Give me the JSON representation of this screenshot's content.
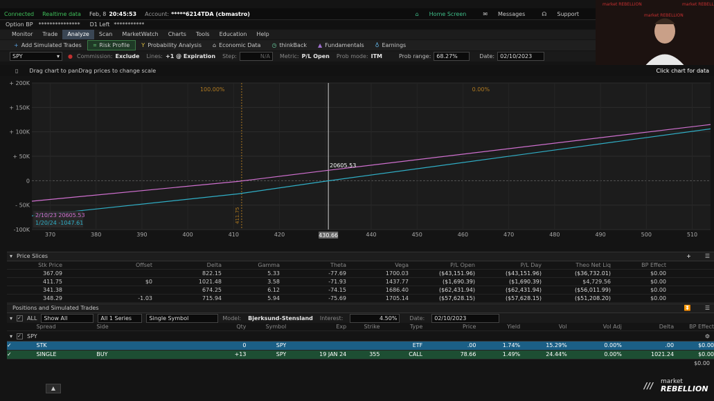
{
  "status": {
    "connected": "Connected",
    "realtime": "Realtime data",
    "date": "Feb, 8",
    "time": "20:45:53",
    "account_label": "Account:",
    "account": "*****6214TDA (cbmastro)",
    "home": "Home Screen",
    "messages": "Messages",
    "support": "Support"
  },
  "option_bp": {
    "label": "Option BP",
    "value": "***************",
    "d1": "D1 Left",
    "d1_value": "***********"
  },
  "tabs": [
    "Monitor",
    "Trade",
    "Analyze",
    "Scan",
    "MarketWatch",
    "Charts",
    "Tools",
    "Education",
    "Help"
  ],
  "active_tab": "Analyze",
  "toolbar": [
    "Add Simulated Trades",
    "Risk Profile",
    "Probability Analysis",
    "Economic Data",
    "thinkBack",
    "Fundamentals",
    "Earnings"
  ],
  "settings": {
    "symbol": "SPY",
    "commission_label": "Commission:",
    "commission": "Exclude",
    "lines_label": "Lines:",
    "lines": "+1 @ Expiration",
    "step_label": "Step:",
    "step": "N/A",
    "metric_label": "Metric:",
    "metric": "P/L Open",
    "probmode_label": "Prob mode:",
    "probmode": "ITM",
    "probrange_label": "Prob range:",
    "probrange": "68.27%",
    "date_label": "Date:",
    "date": "02/10/2023"
  },
  "hint": "Drag chart to panDrag prices to change scale",
  "click_hint": "Click chart for data",
  "chart_data": {
    "type": "line",
    "x_ticks": [
      370,
      380,
      390,
      400,
      410,
      420,
      430,
      440,
      450,
      460,
      470,
      480,
      490,
      500,
      510
    ],
    "y_ticks": [
      "+ 200K",
      "+ 150K",
      "+ 100K",
      "+ 50K",
      "0",
      "- 50K",
      "-100K"
    ],
    "y_values": [
      200000,
      150000,
      100000,
      50000,
      0,
      -50000,
      -100000
    ],
    "xlim": [
      366,
      514
    ],
    "ylim": [
      -100000,
      200000
    ],
    "series": [
      {
        "name": "2/10/23 20605.53",
        "color": "#d070d0",
        "points": [
          [
            366,
            -42000
          ],
          [
            411,
            -1500
          ],
          [
            430,
            20605
          ],
          [
            514,
            115000
          ]
        ]
      },
      {
        "name": "1/20/24 -1047.61",
        "color": "#30b0c8",
        "points": [
          [
            366,
            -72000
          ],
          [
            411,
            -27000
          ],
          [
            430,
            -1048
          ],
          [
            514,
            106000
          ]
        ]
      }
    ],
    "cursor_x_label": "430.66",
    "cursor_value": "20605.53",
    "left_marker_label": "411.75",
    "left_prob": "100.00%",
    "right_prob": "0.00%"
  },
  "slices": {
    "title": "Price Slices",
    "headers": [
      "Stk Price",
      "Offset",
      "Delta",
      "Gamma",
      "Theta",
      "Vega",
      "P/L Open",
      "P/L Day",
      "Theo Net Liq",
      "BP Effect"
    ],
    "rows": [
      [
        "367.09",
        "",
        "822.15",
        "5.33",
        "-77.69",
        "1700.03",
        "($43,151.96)",
        "($43,151.96)",
        "($36,732.01)",
        "$0.00"
      ],
      [
        "411.75",
        "$0",
        "1021.48",
        "3.58",
        "-71.93",
        "1437.77",
        "($1,690.39)",
        "($1,690.39)",
        "$4,729.56",
        "$0.00"
      ],
      [
        "341.38",
        "",
        "674.25",
        "6.12",
        "-74.15",
        "1686.40",
        "($62,431.94)",
        "($62,431.94)",
        "($56,011.99)",
        "$0.00"
      ],
      [
        "348.29",
        "-1.03",
        "715.94",
        "5.94",
        "-75.69",
        "1705.14",
        "($57,628.15)",
        "($57,628.15)",
        "($51,208.20)",
        "$0.00"
      ]
    ]
  },
  "positions": {
    "title": "Positions and Simulated Trades",
    "filter": {
      "all": "ALL",
      "show": "Show All",
      "series": "All 1 Series",
      "symbol": "Single Symbol",
      "model_label": "Model:",
      "model": "Bjerksund-Stensland",
      "interest_label": "Interest:",
      "interest": "4.50%",
      "date_label": "Date:",
      "date": "02/10/2023"
    },
    "headers": [
      "Spread",
      "Side",
      "Qty",
      "Symbol",
      "Exp",
      "Strike",
      "Type",
      "Price",
      "Yield",
      "Vol",
      "Vol Adj",
      "Delta",
      "BP Effect"
    ],
    "group": "SPY",
    "rows": [
      [
        "STK",
        "",
        "0",
        "SPY",
        "",
        "",
        "ETF",
        ".00",
        "1.74%",
        "15.29%",
        "0.00%",
        ".00",
        "$0.00"
      ],
      [
        "SINGLE",
        "BUY",
        "+13",
        "SPY",
        "19 JAN 24",
        "355",
        "CALL",
        "78.66",
        "1.49%",
        "24.44%",
        "0.00%",
        "1021.24",
        "$0.00"
      ]
    ],
    "total": "$0.00"
  },
  "brand": {
    "top": "market",
    "bottom": "REBELLION"
  }
}
